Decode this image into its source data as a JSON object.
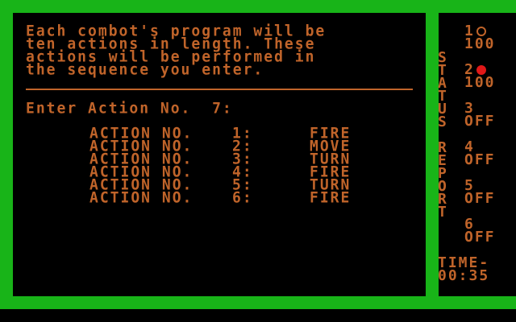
{
  "intro_lines": [
    "Each combot's program will be",
    "ten actions in length. These",
    "actions will be performed in",
    "the sequence you enter."
  ],
  "prompt": "Enter Action No.  7:",
  "actions": [
    {
      "label": "ACTION NO.",
      "num": "1:",
      "cmd": "FIRE"
    },
    {
      "label": "ACTION NO.",
      "num": "2:",
      "cmd": "MOVE"
    },
    {
      "label": "ACTION NO.",
      "num": "3:",
      "cmd": "TURN"
    },
    {
      "label": "ACTION NO.",
      "num": "4:",
      "cmd": "FIRE"
    },
    {
      "label": "ACTION NO.",
      "num": "5:",
      "cmd": "TURN"
    },
    {
      "label": "ACTION NO.",
      "num": "6:",
      "cmd": "FIRE"
    }
  ],
  "status": {
    "title_chars": [
      "S",
      "T",
      "A",
      "T",
      "U",
      "S",
      "",
      "R",
      "E",
      "P",
      "O",
      "R",
      "T"
    ],
    "combots": [
      {
        "id": "1",
        "value": "100",
        "marker": "ring"
      },
      {
        "id": "2",
        "value": "100",
        "marker": "red-dot"
      },
      {
        "id": "3",
        "value": "OFF",
        "marker": ""
      },
      {
        "id": "4",
        "value": "OFF",
        "marker": ""
      },
      {
        "id": "5",
        "value": "OFF",
        "marker": ""
      },
      {
        "id": "6",
        "value": "OFF",
        "marker": ""
      }
    ],
    "time_label": "TIME-",
    "time_value": "00:35"
  },
  "colors": {
    "frame": "#18b418",
    "text": "#c0642a",
    "marker_red": "#e01818",
    "background": "#000000"
  }
}
